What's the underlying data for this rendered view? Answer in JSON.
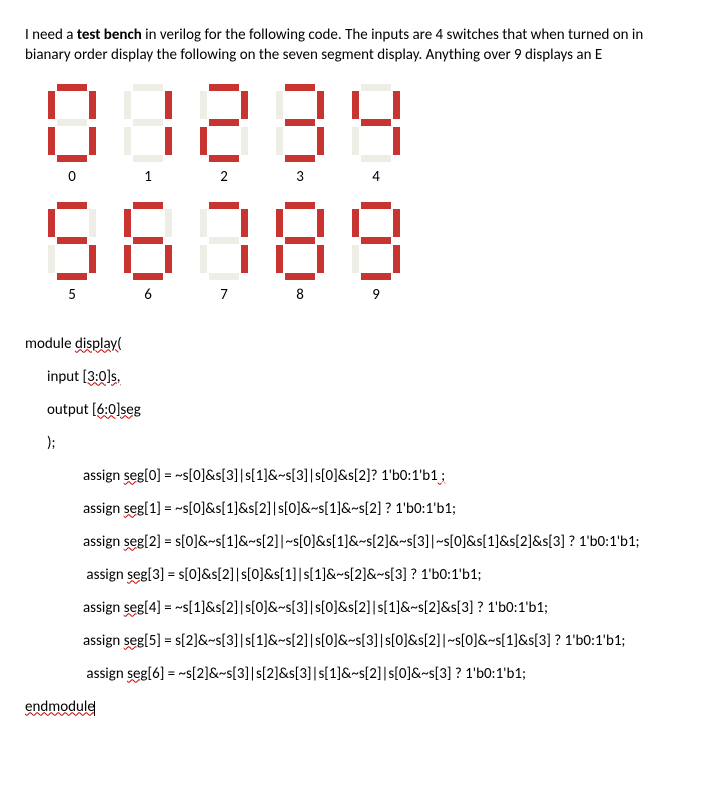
{
  "intro": {
    "pre": "I need a ",
    "bold": "test bench",
    "post": " in verilog for the following code. The inputs are 4 switches that when turned on in bianary order display the following on the seven segment display. Anything over 9 displays an E"
  },
  "digits": {
    "row1": [
      {
        "label": "0",
        "on": [
          "a",
          "b",
          "c",
          "d",
          "e",
          "f"
        ]
      },
      {
        "label": "1",
        "on": [
          "b",
          "c"
        ]
      },
      {
        "label": "2",
        "on": [
          "a",
          "b",
          "d",
          "e",
          "g"
        ]
      },
      {
        "label": "3",
        "on": [
          "a",
          "b",
          "c",
          "d",
          "g"
        ]
      },
      {
        "label": "4",
        "on": [
          "b",
          "c",
          "f",
          "g"
        ]
      }
    ],
    "row2": [
      {
        "label": "5",
        "on": [
          "a",
          "c",
          "d",
          "f",
          "g"
        ]
      },
      {
        "label": "6",
        "on": [
          "a",
          "c",
          "d",
          "e",
          "f",
          "g"
        ]
      },
      {
        "label": "7",
        "on": [
          "a",
          "b",
          "c"
        ]
      },
      {
        "label": "8",
        "on": [
          "a",
          "b",
          "c",
          "d",
          "e",
          "f",
          "g"
        ]
      },
      {
        "label": "9",
        "on": [
          "a",
          "b",
          "c",
          "d",
          "f",
          "g"
        ]
      }
    ]
  },
  "code": {
    "l1_pre": "module ",
    "l1_sq": "display(",
    "l2_pre": "input ",
    "l2_sq": "[3:0]s,",
    "l3_pre": "output ",
    "l3_sq": "[6:0]seg",
    "l4": ");",
    "a0_pre": "assign ",
    "a0_sq": "seg[",
    "a0_post": "0] = ~s[0]&s[3]|s[1]&~s[3]|s[0]&s[2]? 1'b0:1'b1",
    "a0_end": " ;",
    "a1_pre": "assign ",
    "a1_sq": "seg[",
    "a1_post": "1] = ~s[0]&s[1]&s[2]|s[0]&~s[1]&~s[2] ? 1'b0:1'b1;",
    "a2_pre": "assign ",
    "a2_sq": "seg[",
    "a2_post": "2] = s[0]&~s[1]&~s[2]|~s[0]&s[1]&~s[2]&~s[3]|~s[0]&s[1]&s[2]&s[3] ? 1'b0:1'b1;",
    "a3_pre": " assign ",
    "a3_sq": "seg[",
    "a3_post": "3] = s[0]&s[2]|s[0]&s[1]|s[1]&~s[2]&~s[3] ? 1'b0:1'b1;",
    "a4_pre": "assign ",
    "a4_sq": "seg[",
    "a4_post": "4] = ~s[1]&s[2]|s[0]&~s[3]|s[0]&s[2]|s[1]&~s[2]&s[3] ? 1'b0:1'b1;",
    "a5_pre": "assign ",
    "a5_sq": "seg[",
    "a5_post": "5] = s[2]&~s[3]|s[1]&~s[2]|s[0]&~s[3]|s[0]&s[2]|~s[0]&~s[1]&s[3] ? 1'b0:1'b1;",
    "a6_pre": " assign ",
    "a6_sq": "seg[",
    "a6_post": "6] = ~s[2]&~s[3]|s[2]&s[3]|s[1]&~s[2]|s[0]&~s[3] ? 1'b0:1'b1;",
    "end_sq": "endmodule"
  }
}
